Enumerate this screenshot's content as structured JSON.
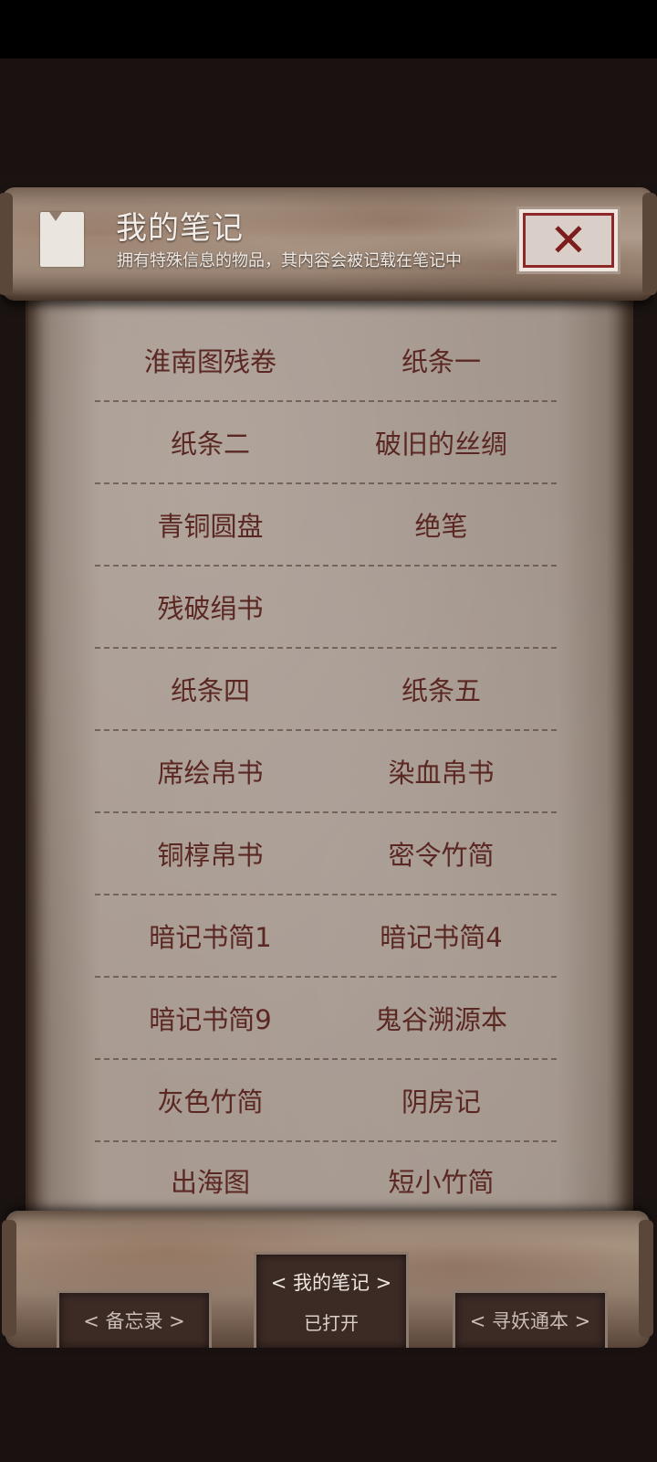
{
  "header": {
    "title": "我的笔记",
    "subtitle": "拥有特殊信息的物品，其内容会被记载在笔记中",
    "close_icon": "close-x-icon"
  },
  "notes": [
    [
      "淮南图残卷",
      "纸条一"
    ],
    [
      "纸条二",
      "破旧的丝绸"
    ],
    [
      "青铜圆盘",
      "绝笔"
    ],
    [
      "残破绢书",
      ""
    ],
    [
      "纸条四",
      "纸条五"
    ],
    [
      "席绘帛书",
      "染血帛书"
    ],
    [
      "铜椁帛书",
      "密令竹简"
    ],
    [
      "暗记书简1",
      "暗记书简4"
    ],
    [
      "暗记书简9",
      "鬼谷溯源本"
    ],
    [
      "灰色竹简",
      "阴房记"
    ],
    [
      "出海图",
      "短小竹简"
    ]
  ],
  "tabs": {
    "left": "< 备忘录 >",
    "center": "< 我的笔记 >",
    "center_status": "已打开",
    "right": "< 寻妖通本 >"
  },
  "colors": {
    "item_text": "#5a2722",
    "parchment": "#a69990",
    "background": "#1a1311"
  }
}
